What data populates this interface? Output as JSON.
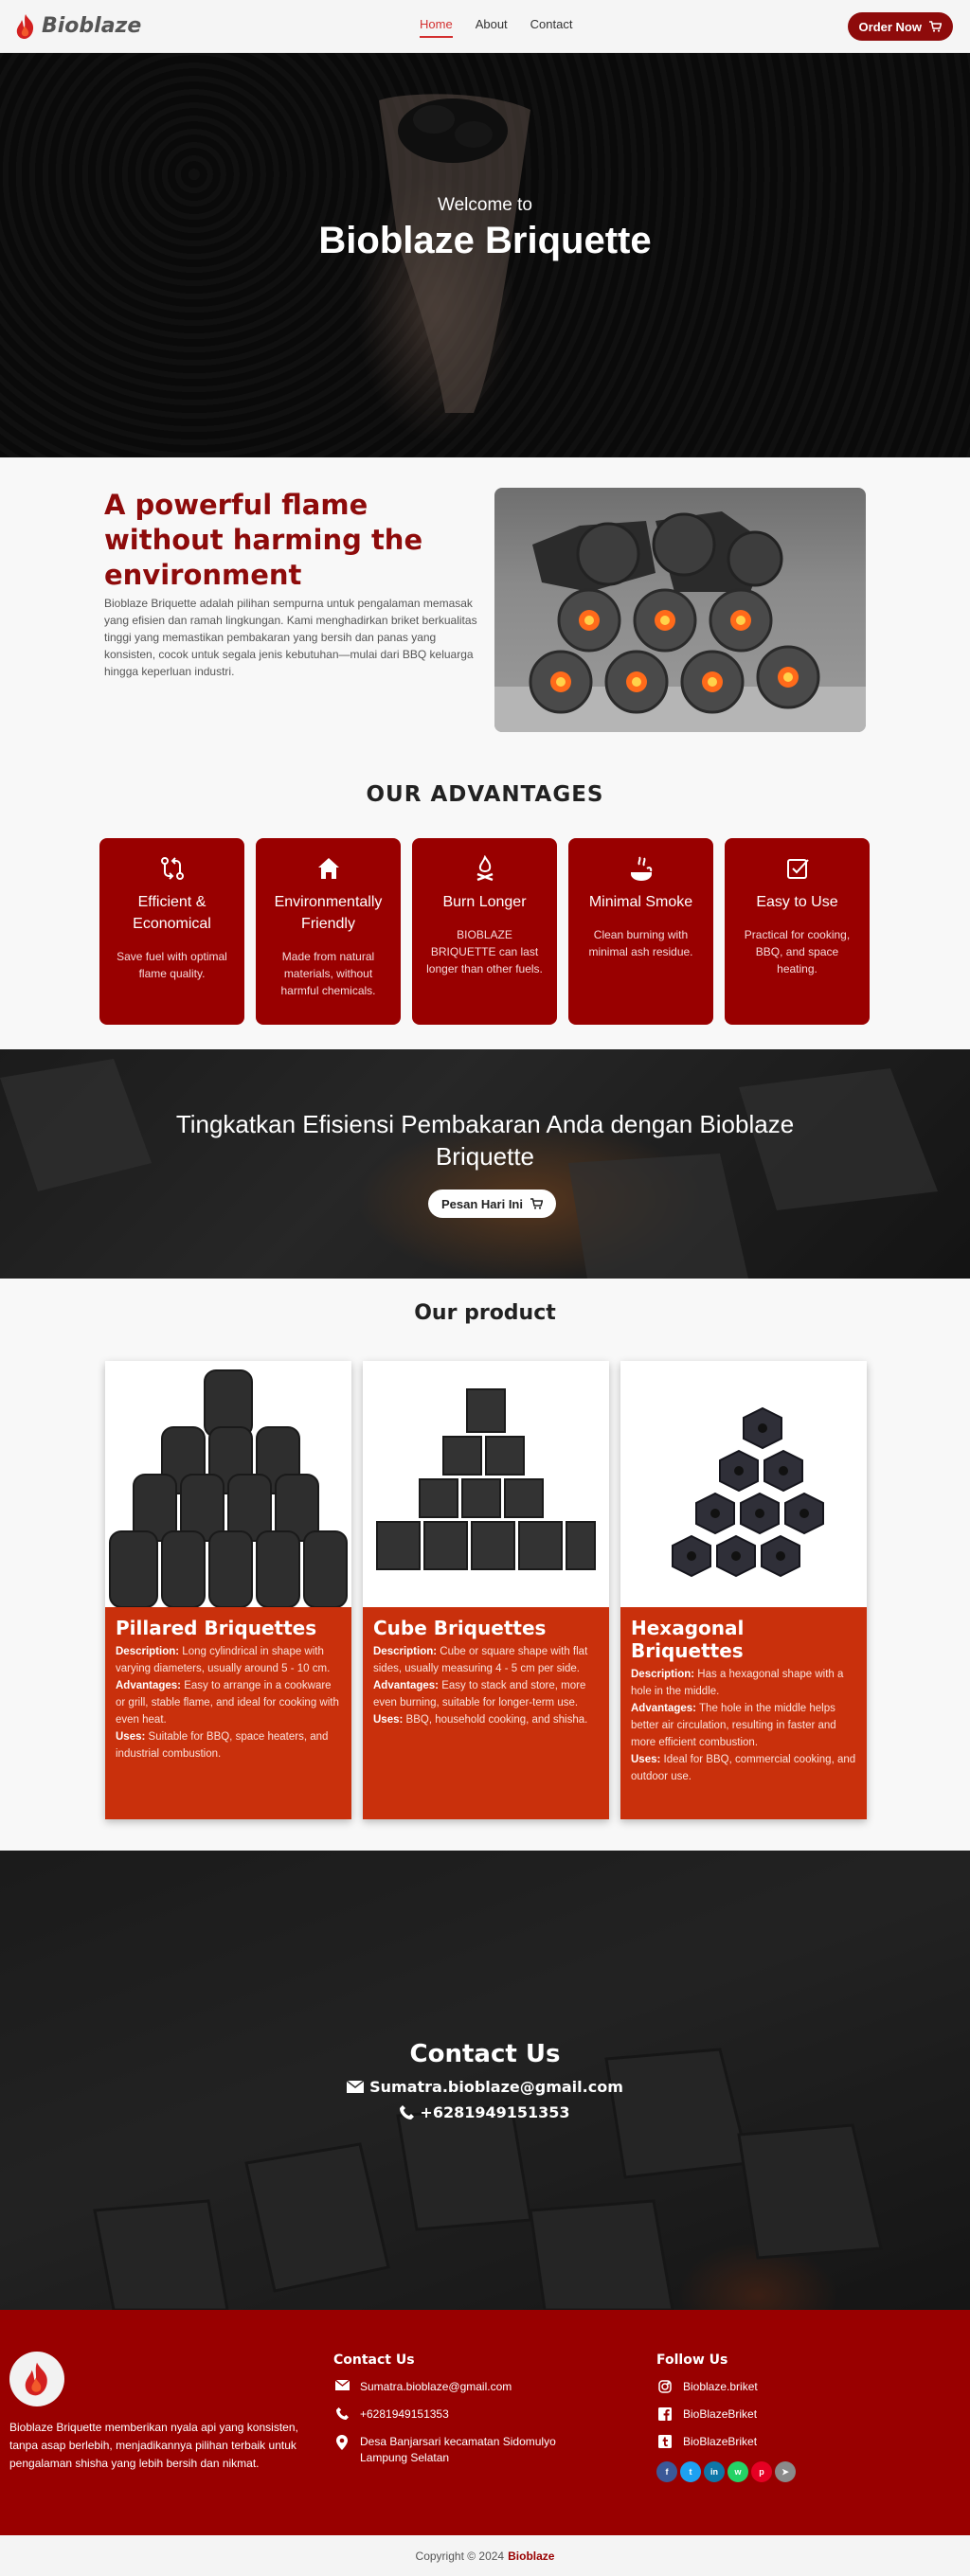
{
  "header": {
    "brand": "Bioblaze",
    "nav": [
      {
        "label": "Home",
        "active": true
      },
      {
        "label": "About",
        "active": false
      },
      {
        "label": "Contact",
        "active": false
      }
    ],
    "order_button": "Order Now"
  },
  "hero": {
    "welcome": "Welcome to",
    "title": "Bioblaze Briquette"
  },
  "intro": {
    "title": "A powerful flame without harming the environment",
    "description": "Bioblaze Briquette adalah pilihan sempurna untuk pengalaman memasak yang efisien dan ramah lingkungan. Kami menghadirkan briket berkualitas tinggi yang memastikan pembakaran yang bersih dan panas yang konsisten, cocok untuk segala jenis kebutuhan—mulai dari BBQ keluarga hingga keperluan industri."
  },
  "advantages": {
    "title": "OUR ADVANTAGES",
    "items": [
      {
        "icon": "transfer-icon",
        "title": "Efficient & Economical",
        "text": "Save fuel with optimal flame quality."
      },
      {
        "icon": "home-icon",
        "title": "Environmentally Friendly",
        "text": "Made from natural materials, without harmful chemicals."
      },
      {
        "icon": "campfire-icon",
        "title": "Burn Longer",
        "text": "BIOBLAZE BRIQUETTE can last longer than other fuels."
      },
      {
        "icon": "smoke-icon",
        "title": "Minimal Smoke",
        "text": "Clean burning with minimal ash residue."
      },
      {
        "icon": "checkbox-icon",
        "title": "Easy to Use",
        "text": "Practical for cooking, BBQ, and space heating."
      }
    ]
  },
  "cta": {
    "text": "Tingkatkan Efisiensi Pembakaran Anda dengan Bioblaze Briquette",
    "button": "Pesan Hari Ini"
  },
  "products": {
    "title": "Our product",
    "items": [
      {
        "name": "Pillared Briquettes",
        "description_label": "Description:",
        "description": "Long cylindrical in shape with varying diameters, usually around 5 - 10 cm.",
        "advantages_label": "Advantages:",
        "advantages": "Easy to arrange in a cookware or grill, stable flame, and ideal for cooking with even heat.",
        "uses_label": "Uses:",
        "uses": "Suitable for BBQ, space heaters, and industrial combustion."
      },
      {
        "name": "Cube Briquettes",
        "description_label": "Description:",
        "description": "Cube or square shape with flat sides, usually measuring 4 - 5 cm per side.",
        "advantages_label": "Advantages:",
        "advantages": "Easy to stack and store, more even burning, suitable for longer-term use.",
        "uses_label": "Uses:",
        "uses": "BBQ, household cooking, and shisha."
      },
      {
        "name": "Hexagonal Briquettes",
        "description_label": "Description:",
        "description": "Has a hexagonal shape with a hole in the middle.",
        "advantages_label": "Advantages:",
        "advantages": "The hole in the middle helps better air circulation, resulting in faster and more efficient combustion.",
        "uses_label": "Uses:",
        "uses": "Ideal for BBQ, commercial cooking, and outdoor use."
      }
    ]
  },
  "contact": {
    "title": "Contact Us",
    "email": "Sumatra.bioblaze@gmail.com",
    "phone": "+6281949151353"
  },
  "footer": {
    "description": "Bioblaze Briquette memberikan nyala api yang konsisten, tanpa asap berlebih, menjadikannya pilihan terbaik untuk pengalaman shisha yang lebih bersih dan nikmat.",
    "contact_title": "Contact Us",
    "contact_email": "Sumatra.bioblaze@gmail.com",
    "contact_phone": "+6281949151353",
    "contact_address": "Desa Banjarsari kecamatan Sidomulyo Lampung Selatan",
    "follow_title": "Follow Us",
    "follow": [
      {
        "icon": "instagram-icon",
        "label": "Bioblaze.briket"
      },
      {
        "icon": "facebook-icon",
        "label": "BioBlazeBriket"
      },
      {
        "icon": "tumblr-icon",
        "label": "BioBlazeBriket"
      }
    ],
    "social_icons": [
      {
        "icon": "facebook-icon",
        "glyph": "f",
        "color": "#3b5998"
      },
      {
        "icon": "twitter-icon",
        "glyph": "t",
        "color": "#1da1f2"
      },
      {
        "icon": "linkedin-icon",
        "glyph": "in",
        "color": "#0e76a8"
      },
      {
        "icon": "whatsapp-icon",
        "glyph": "w",
        "color": "#25d366"
      },
      {
        "icon": "pinterest-icon",
        "glyph": "p",
        "color": "#e60023"
      },
      {
        "icon": "telegram-icon",
        "glyph": "➤",
        "color": "#8a8a8a"
      }
    ],
    "copyright_prefix": "Copyright © 2024",
    "copyright_brand": "Bioblaze"
  },
  "colors": {
    "brand_red": "#990000",
    "accent_orange": "#c9300c",
    "nav_active": "#d32f2f"
  }
}
